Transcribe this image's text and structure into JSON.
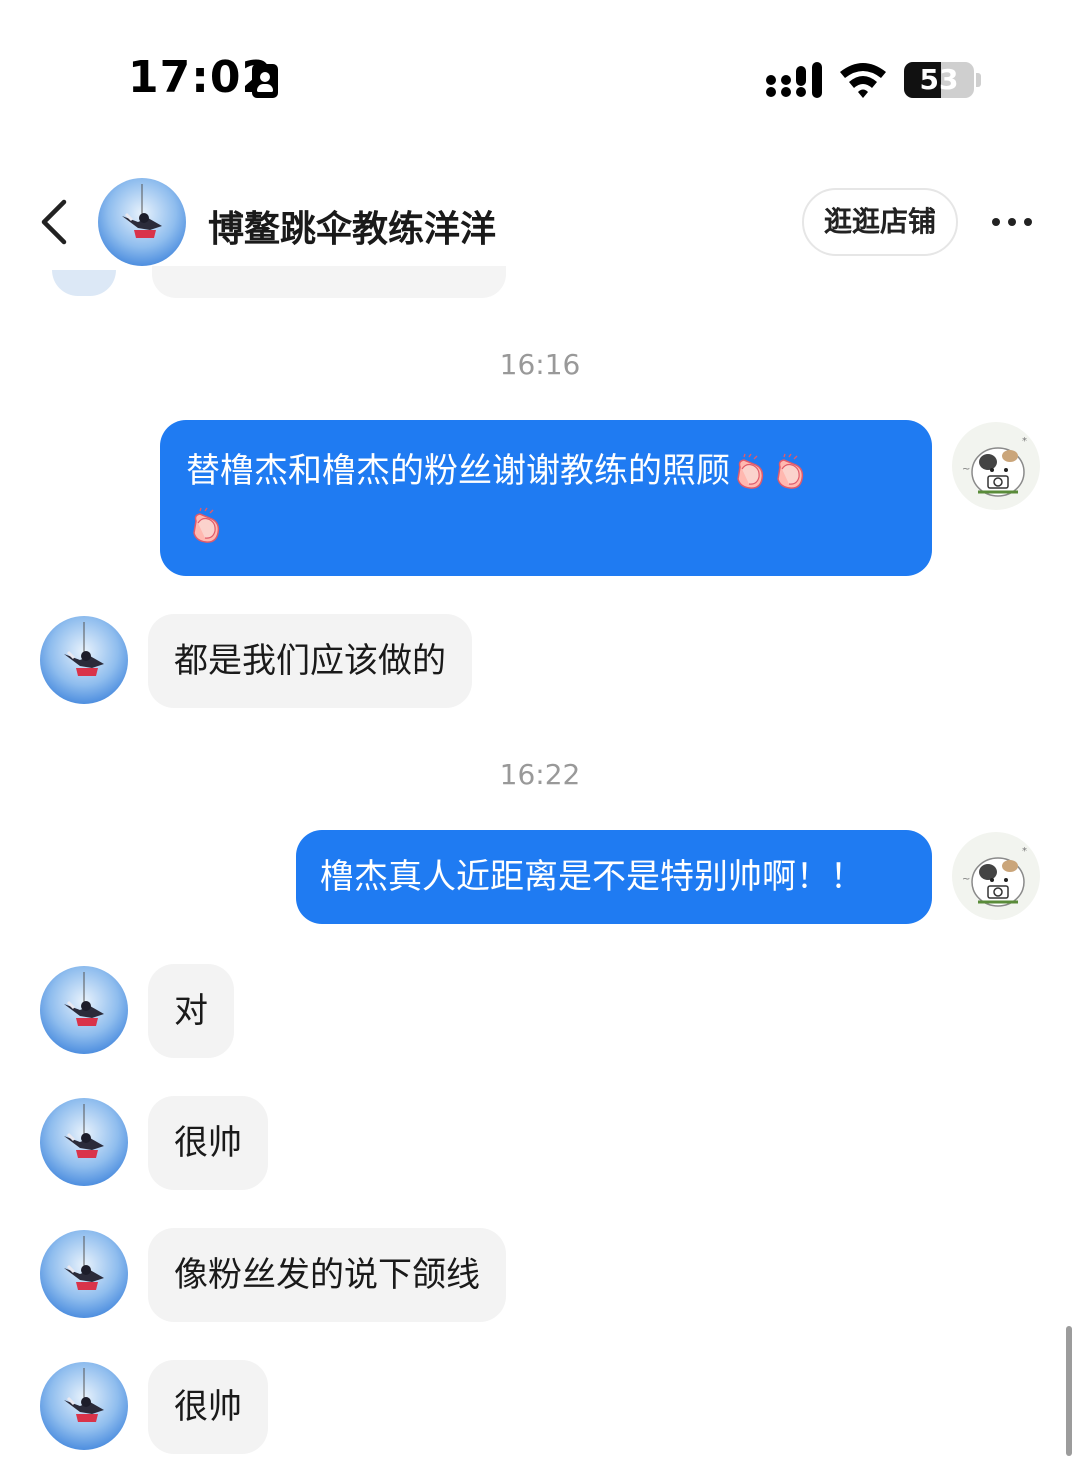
{
  "status_bar": {
    "time": "17:02",
    "battery": "53",
    "battery_level": 0.53
  },
  "header": {
    "title": "博鳌跳伞教练洋洋",
    "shop_button": "逛逛店铺"
  },
  "messages": [
    {
      "type": "timestamp",
      "text": "16:16"
    },
    {
      "type": "outgoing",
      "line1": "替橹杰和橹杰的粉丝谢谢教练的照顾"
    },
    {
      "type": "incoming",
      "text": "都是我们应该做的"
    },
    {
      "type": "timestamp",
      "text": "16:22"
    },
    {
      "type": "outgoing",
      "text": "橹杰真人近距离是不是特别帅啊！！"
    },
    {
      "type": "incoming",
      "text": "对"
    },
    {
      "type": "incoming",
      "text": "很帅"
    },
    {
      "type": "incoming",
      "text": "像粉丝发的说下颌线"
    },
    {
      "type": "incoming",
      "text": "很帅"
    }
  ],
  "icons": {
    "back": "chevron-left-icon",
    "more": "more-dots-icon",
    "clap": "clapping-hands-icon"
  },
  "colors": {
    "outgoing_bubble": "#1f7bf2",
    "incoming_bubble": "#f3f3f3"
  }
}
